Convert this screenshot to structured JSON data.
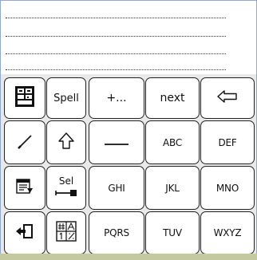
{
  "text_area": {
    "lines": 4
  },
  "keys": {
    "row1": {
      "spell": "Spell",
      "punct": "+...",
      "next": "next"
    },
    "row2": {
      "abc": "ABC",
      "def": "DEF"
    },
    "row3": {
      "sel": "Sel",
      "ghi": "GHI",
      "jkl": "JKL",
      "mno": "MNO"
    },
    "row4": {
      "pqrs": "PQRS",
      "tuv": "TUV",
      "wxyz": "WXYZ"
    }
  },
  "icons": {
    "symbols_grid": "keyboard-symbols-icon",
    "backspace": "backspace-arrow-icon",
    "pen": "pen-icon",
    "shift": "shift-arrow-icon",
    "space": "space-bar-icon",
    "menu": "menu-list-icon",
    "sel_key": "selection-key-icon",
    "exit": "exit-door-icon",
    "numeric": "numeric-keypad-icon"
  },
  "colors": {
    "frame_border": "#8ea9d8",
    "keyboard_bg": "#e8eae8",
    "bottom_bar": "#c5c9a0"
  }
}
